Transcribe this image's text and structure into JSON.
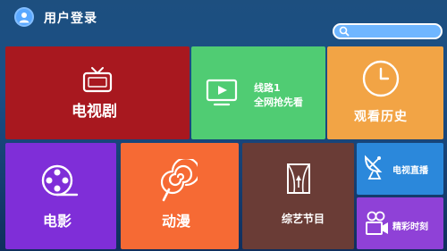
{
  "header": {
    "title": "用户登录",
    "search_placeholder": ""
  },
  "tiles": {
    "tv_series": {
      "label": "电视剧",
      "icon": "tv-icon",
      "color": "#a8181f"
    },
    "line": {
      "line1": "线路1",
      "line2": "全网抢先看",
      "icon": "video-play-icon",
      "color": "#50cc73"
    },
    "history": {
      "label": "观看历史",
      "icon": "clock-icon",
      "color": "#f2a445"
    },
    "movie": {
      "label": "电影",
      "icon": "film-reel-icon",
      "color": "#7f2ed8"
    },
    "anime": {
      "label": "动漫",
      "icon": "lollipop-icon",
      "color": "#f66a34"
    },
    "variety": {
      "label": "综艺节目",
      "icon": "stage-curtain-icon",
      "color": "#6a3c36"
    },
    "live": {
      "label": "电视直播",
      "icon": "satellite-dish-icon",
      "color": "#2b88db"
    },
    "highlights": {
      "label": "精彩时刻",
      "icon": "video-camera-icon",
      "color": "#8f41d7"
    }
  }
}
